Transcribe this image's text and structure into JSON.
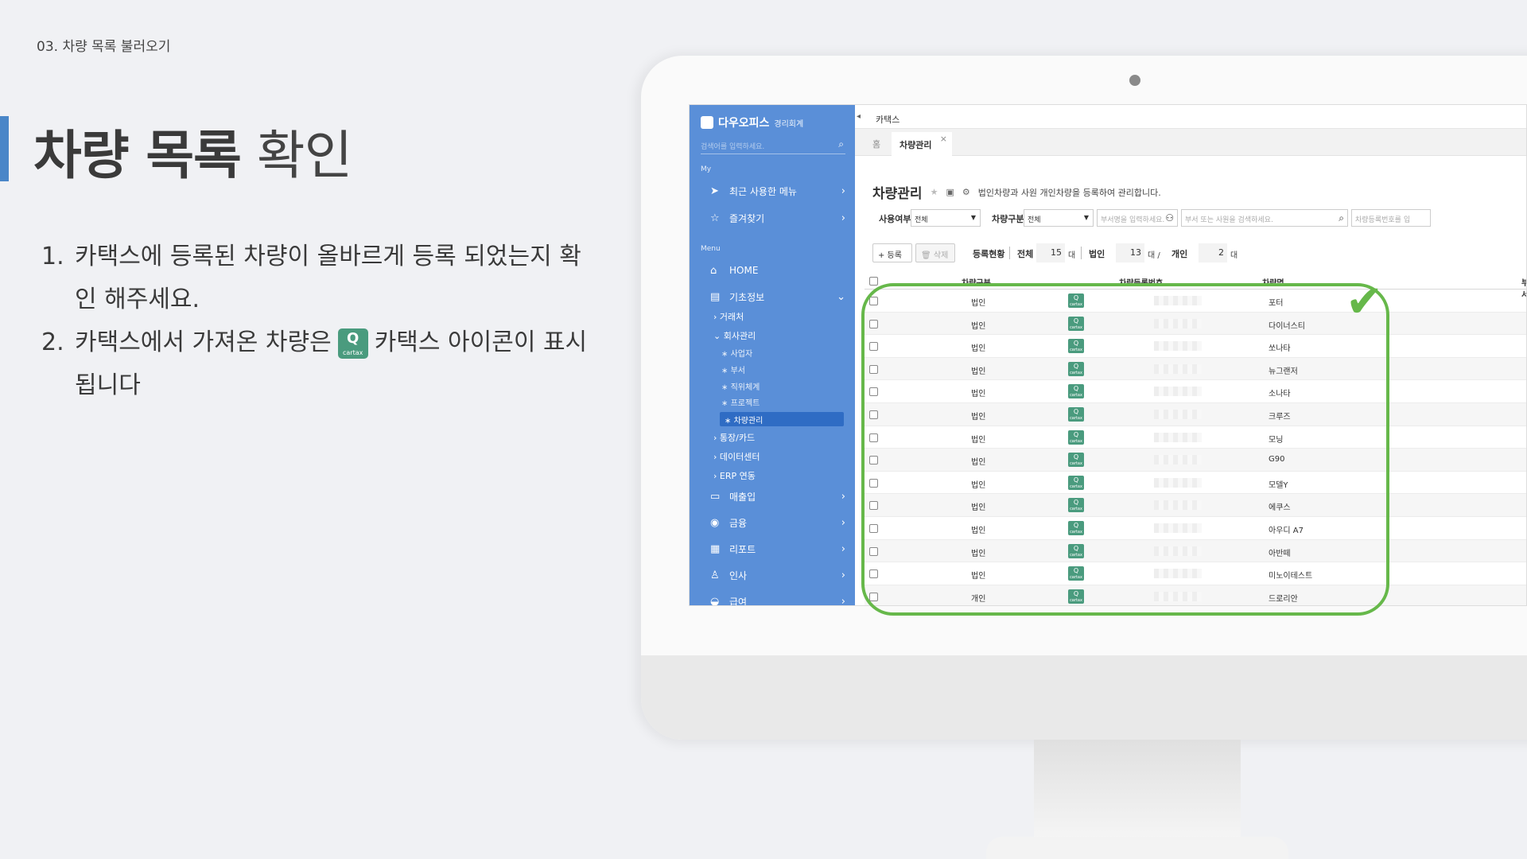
{
  "slide": {
    "section": "03. 차량 목록 불러오기",
    "title_strong": "차량 목록",
    "title_light": "확인",
    "steps": [
      {
        "num": "1.",
        "text": "카택스에 등록된 차량이 올바르게 등록 되었는지 확인 해주세요."
      },
      {
        "num": "2.",
        "text_before": "카택스에서 가져온 차량은",
        "text_after": "카택스 아이콘이 표시 됩니다"
      }
    ],
    "icon": {
      "glyph": "Q",
      "caption": "cartax"
    }
  },
  "app": {
    "brand": "다우오피스",
    "brand_sub": "경리회계",
    "search_placeholder": "검색어를 입력하세요.",
    "my_label": "My",
    "menu_label": "Menu",
    "nav": {
      "recent": "최근 사용한 메뉴",
      "favorites": "즐겨찾기",
      "home": "HOME",
      "basic": "기초정보",
      "partner": "거래처",
      "company": "회사관리",
      "business": "사업자",
      "dept": "부서",
      "position": "직위체계",
      "project": "프로젝트",
      "vehicle": "차량관리",
      "bank": "통장/카드",
      "datacenter": "데이터센터",
      "erp": "ERP 연동",
      "sales": "매출입",
      "finance": "금융",
      "report": "리포트",
      "hr": "인사",
      "payroll": "급여"
    },
    "topbar_title": "카택스",
    "tabs": {
      "home": "홈",
      "active": "차량관리"
    },
    "page_title": "차량관리",
    "page_desc": "법인차량과 사원 개인차량을 등록하여 관리합니다.",
    "filters": {
      "usage_label": "사용여부",
      "usage_value": "전체",
      "type_label": "차량구분",
      "type_value": "전체",
      "dept_placeholder": "부서명을 입력하세요.",
      "person_placeholder": "부서 또는 사원을 검색하세요.",
      "plate_placeholder": "차량등록번호를 입"
    },
    "toolbar": {
      "add": "+ 등록",
      "delete": "삭제",
      "status_label": "등록현황",
      "total_label": "전체",
      "total_count": "15",
      "corp_label": "법인",
      "corp_count": "13",
      "personal_label": "개인",
      "personal_count": "2",
      "unit": "대",
      "unit_slash": "대 /"
    },
    "table": {
      "headers": [
        "차량구분",
        "차량등록번호",
        "차량명",
        "부서"
      ],
      "rows": [
        {
          "type": "법인",
          "name": "포터"
        },
        {
          "type": "법인",
          "name": "다이너스티"
        },
        {
          "type": "법인",
          "name": "쏘나타"
        },
        {
          "type": "법인",
          "name": "뉴그랜저"
        },
        {
          "type": "법인",
          "name": "소나타"
        },
        {
          "type": "법인",
          "name": "크루즈"
        },
        {
          "type": "법인",
          "name": "모닝"
        },
        {
          "type": "법인",
          "name": "G90"
        },
        {
          "type": "법인",
          "name": "모델Y"
        },
        {
          "type": "법인",
          "name": "에쿠스"
        },
        {
          "type": "법인",
          "name": "아우디 A7"
        },
        {
          "type": "법인",
          "name": "아반떼"
        },
        {
          "type": "법인",
          "name": "미노이테스트"
        },
        {
          "type": "개인",
          "name": "드로리안"
        }
      ]
    }
  },
  "colors": {
    "accent": "#4a86c8",
    "sidebar": "#5a8fd8",
    "cartax": "#4a9b7e",
    "highlight": "#66b84a"
  }
}
